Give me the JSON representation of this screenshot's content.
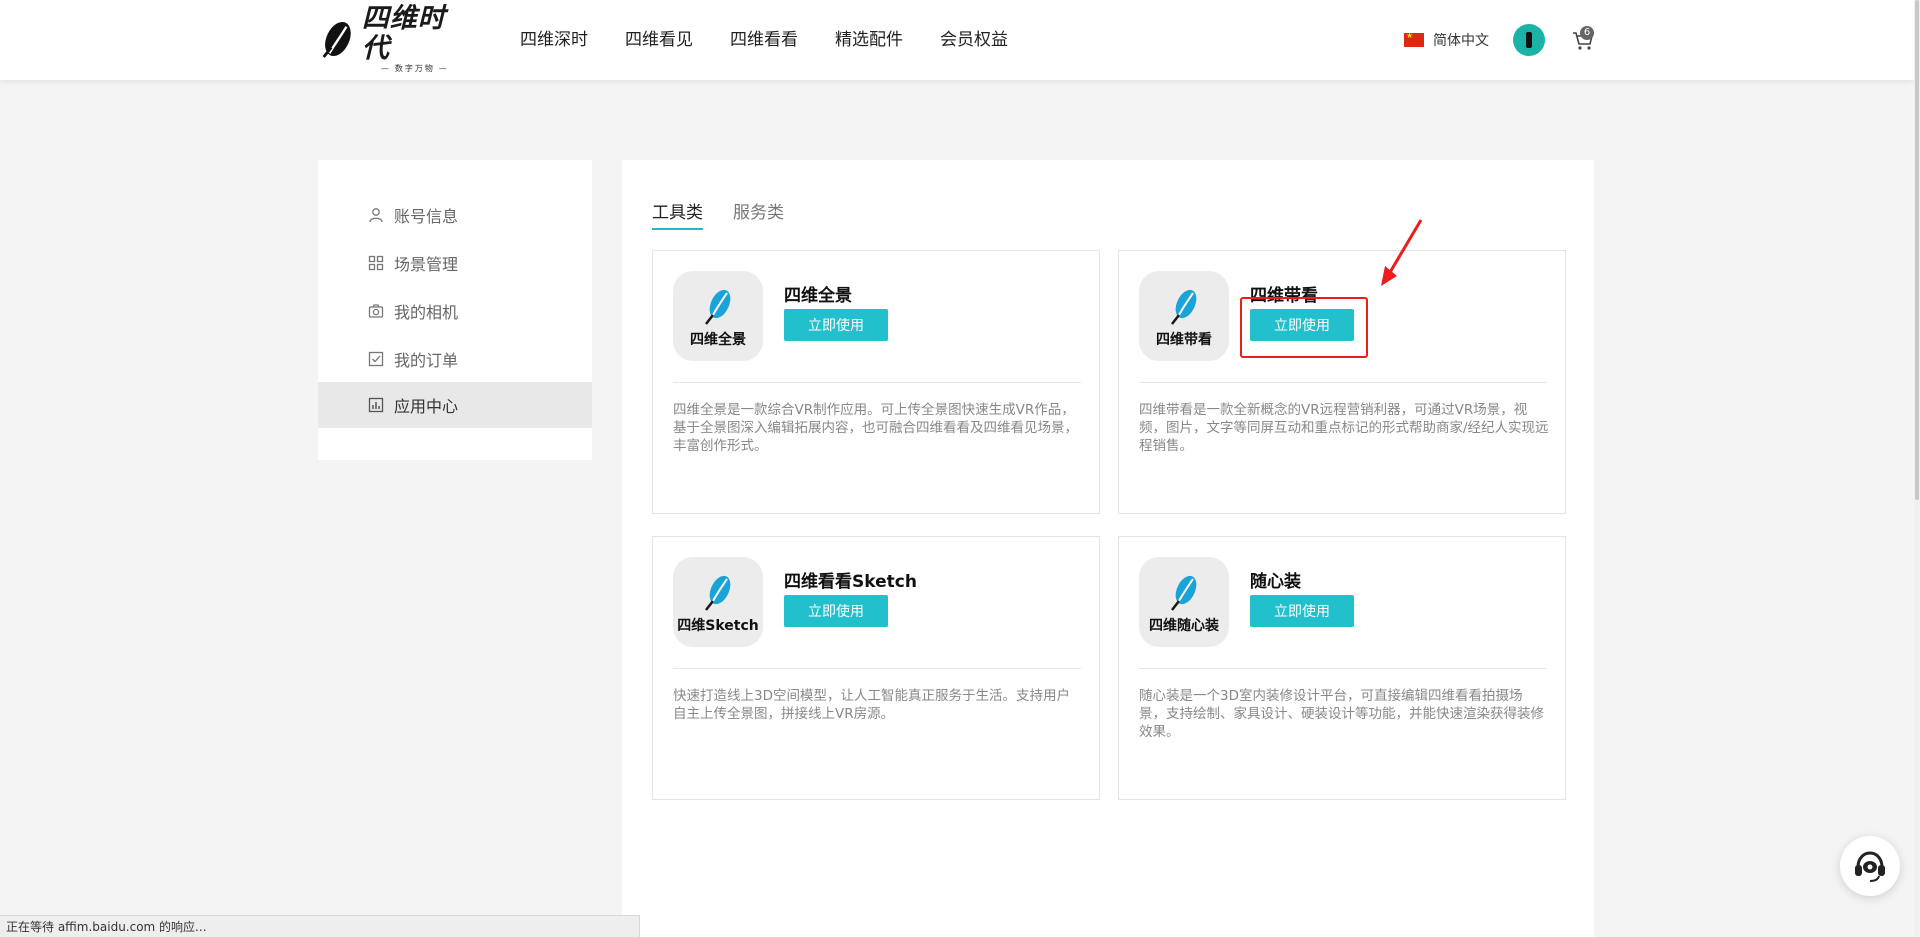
{
  "brand": {
    "name": "四维时代",
    "tagline": "数字万物"
  },
  "nav": {
    "items": [
      {
        "label": "四维深时"
      },
      {
        "label": "四维看见"
      },
      {
        "label": "四维看看"
      },
      {
        "label": "精选配件"
      },
      {
        "label": "会员权益"
      }
    ]
  },
  "header": {
    "language": "简体中文",
    "cart_count": "6",
    "avatar_color": "#1ab3a6"
  },
  "sidebar": {
    "items": [
      {
        "label": "账号信息",
        "icon": "user-icon"
      },
      {
        "label": "场景管理",
        "icon": "grid-icon"
      },
      {
        "label": "我的相机",
        "icon": "camera-icon"
      },
      {
        "label": "我的订单",
        "icon": "order-icon"
      },
      {
        "label": "应用中心",
        "icon": "chart-icon",
        "active": true
      }
    ]
  },
  "tabs": [
    {
      "label": "工具类",
      "active": true
    },
    {
      "label": "服务类",
      "active": false
    }
  ],
  "apps": [
    {
      "icon_label": "四维全景",
      "title": "四维全景",
      "button": "立即使用",
      "description": "四维全景是一款综合VR制作应用。可上传全景图快速生成VR作品，基于全景图深入编辑拓展内容，也可融合四维看看及四维看见场景，丰富创作形式。"
    },
    {
      "icon_label": "四维带看",
      "title": "四维带看",
      "button": "立即使用",
      "description": "四维带看是一款全新概念的VR远程营销利器，可通过VR场景，视频，图片，文字等同屏互动和重点标记的形式帮助商家/经纪人实现远程销售。"
    },
    {
      "icon_label": "四维Sketch",
      "title": "四维看看Sketch",
      "button": "立即使用",
      "description": "快速打造线上3D空间模型，让人工智能真正服务于生活。支持用户自主上传全景图，拼接线上VR房源。"
    },
    {
      "icon_label": "四维随心装",
      "title": "随心装",
      "button": "立即使用",
      "description": "随心装是一个3D室内装修设计平台，可直接编辑四维看看拍摄场景，支持绘制、家具设计、硬装设计等功能，并能快速渲染获得装修效果。"
    }
  ],
  "colors": {
    "accent": "#22bfcc",
    "highlight": "#ee1c1c"
  },
  "status_bar": "正在等待 affim.baidu.com 的响应..."
}
